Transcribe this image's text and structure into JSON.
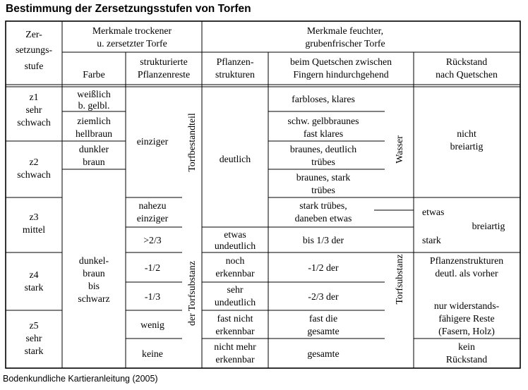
{
  "title": "Bestimmung der Zersetzungsstufen von Torfen",
  "caption": "Bodenkundliche Kartieranleitung (2005)",
  "header": {
    "stage": [
      "Zer-",
      "setzungs-",
      "stufe"
    ],
    "dry_group": [
      "Merkmale trockener",
      "u. zersetzter Torfe"
    ],
    "dry_color": "Farbe",
    "dry_struct": [
      "strukturierte",
      "Pflanzenreste"
    ],
    "wet_group": [
      "Merkmale feuchter,",
      "grubenfrischer Torfe"
    ],
    "plant": [
      "Pflanzen-",
      "strukturen"
    ],
    "squeeze": [
      "beim Quetschen zwischen",
      "Fingern hindurchgehend"
    ],
    "residue": [
      "Rückstand",
      "nach Quetschen"
    ]
  },
  "stages": [
    {
      "code": "z1",
      "lines": [
        "sehr",
        "schwach"
      ]
    },
    {
      "code": "z2",
      "lines": [
        "schwach"
      ]
    },
    {
      "code": "z3",
      "lines": [
        "mittel"
      ]
    },
    {
      "code": "z4",
      "lines": [
        "stark"
      ]
    },
    {
      "code": "z5",
      "lines": [
        "sehr",
        "stark"
      ]
    }
  ],
  "colors": {
    "c1": [
      "weißlich",
      "b. gelbl."
    ],
    "c2": [
      "ziemlich",
      "hellbraun"
    ],
    "c3": [
      "dunkler",
      "braun"
    ],
    "c4": [
      "dunkel-",
      "braun",
      "bis",
      "schwarz"
    ]
  },
  "struct": {
    "s1": "einziger",
    "s2": [
      "nahezu",
      "einziger"
    ],
    "s3": ">2/3",
    "s4": "-1/2",
    "s5": "-1/3",
    "s6": "wenig",
    "s7": "keine",
    "vertical_top": "Torfbestandteil",
    "vertical_bottom": "der Torfsubstanz"
  },
  "plants": {
    "p1": "deutlich",
    "p2": [
      "etwas",
      "undeutlich"
    ],
    "p3": [
      "noch",
      "erkennbar"
    ],
    "p4": [
      "sehr",
      "undeutlich"
    ],
    "p5": [
      "fast nicht",
      "erkennbar"
    ],
    "p6": [
      "nicht mehr",
      "erkennbar"
    ]
  },
  "squeeze": {
    "q1": "farbloses, klares",
    "q2": [
      "schw. gelbbraunes",
      "fast klares"
    ],
    "q3": [
      "braunes, deutlich",
      "trübes"
    ],
    "q4": [
      "braunes, stark",
      "trübes"
    ],
    "q5": [
      "stark trübes,",
      "daneben etwas"
    ],
    "q6": "bis 1/3 der",
    "q7": "-1/2 der",
    "q8": "-2/3 der",
    "q9": [
      "fast die",
      "gesamte"
    ],
    "q10": "gesamte",
    "vertical_water": "Wasser",
    "vertical_substance": "Torfsubstanz"
  },
  "residue": {
    "r1": [
      "nicht",
      "breiartig"
    ],
    "r2a": "etwas",
    "r2b": "stark",
    "r2c": "breiartig",
    "r3": [
      "Pflanzenstrukturen",
      "deutl. als vorher"
    ],
    "r4": [
      "nur widerstands-",
      "fähigere Reste",
      "(Fasern, Holz)"
    ],
    "r5": [
      "kein",
      "Rückstand"
    ]
  }
}
